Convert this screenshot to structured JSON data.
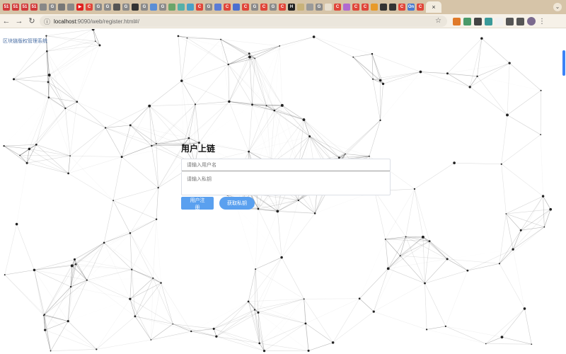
{
  "browser": {
    "tabs": [
      {
        "label": "51",
        "color": "#d23b3b"
      },
      {
        "label": "51",
        "color": "#d23b3b"
      },
      {
        "label": "51",
        "color": "#d23b3b"
      },
      {
        "label": "51",
        "color": "#d23b3b"
      },
      {
        "label": "",
        "color": "#888888"
      },
      {
        "label": "G",
        "color": "#8a8a8a"
      },
      {
        "label": "",
        "color": "#777777"
      },
      {
        "label": "",
        "color": "#888888"
      },
      {
        "label": "▶",
        "color": "#e02020"
      },
      {
        "label": "C",
        "color": "#e0463a"
      },
      {
        "label": "G",
        "color": "#8a8a8a"
      },
      {
        "label": "G",
        "color": "#8a8a8a"
      },
      {
        "label": "",
        "color": "#555555"
      },
      {
        "label": "G",
        "color": "#8a8a8a"
      },
      {
        "label": "",
        "color": "#333333"
      },
      {
        "label": "G",
        "color": "#8a8a8a"
      },
      {
        "label": "",
        "color": "#5a8ed6"
      },
      {
        "label": "G",
        "color": "#8a8a8a"
      },
      {
        "label": "",
        "color": "#6aa56a"
      },
      {
        "label": "",
        "color": "#55b0a8"
      },
      {
        "label": "",
        "color": "#4aa0c8"
      },
      {
        "label": "C",
        "color": "#e0463a"
      },
      {
        "label": "G",
        "color": "#8a8a8a"
      },
      {
        "label": "",
        "color": "#5a7bd6"
      },
      {
        "label": "C",
        "color": "#e0463a"
      },
      {
        "label": "",
        "color": "#4a6fd0"
      },
      {
        "label": "C",
        "color": "#e0463a"
      },
      {
        "label": "G",
        "color": "#8a8a8a"
      },
      {
        "label": "C",
        "color": "#e0463a"
      },
      {
        "label": "G",
        "color": "#8a8a8a"
      },
      {
        "label": "C",
        "color": "#e0463a"
      },
      {
        "label": "H",
        "color": "#222222"
      },
      {
        "label": "",
        "color": "#c8b27a"
      },
      {
        "label": "",
        "color": "#9a9a9a"
      },
      {
        "label": "G",
        "color": "#8a8a8a"
      },
      {
        "label": "",
        "color": "#e8e0d0"
      },
      {
        "label": "C",
        "color": "#e0463a"
      },
      {
        "label": "",
        "color": "#b06ad0"
      },
      {
        "label": "C",
        "color": "#e0463a"
      },
      {
        "label": "C",
        "color": "#e0463a"
      },
      {
        "label": "",
        "color": "#e89a2a"
      },
      {
        "label": "",
        "color": "#333333"
      },
      {
        "label": "",
        "color": "#333333"
      },
      {
        "label": "C",
        "color": "#e0463a"
      },
      {
        "label": "On",
        "color": "#4a7bd0"
      },
      {
        "label": "C",
        "color": "#e0463a"
      }
    ],
    "active_tab_close": "×",
    "tab_menu_icon": "⌄",
    "url_host": "localhost",
    "url_path": ":9090/web/register.html#/",
    "nav_back": "←",
    "nav_forward": "→",
    "nav_reload": "↻",
    "info_icon": "ⓘ",
    "star_icon": "☆",
    "kebab_icon": "⋮",
    "extensions": [
      "#e07a2a",
      "#4a9a6a",
      "#444444",
      "#3a9a9a",
      "#f0f0f0",
      "#555555",
      "#555555"
    ]
  },
  "page": {
    "brand": "区块链版权管理系统",
    "title": "用户上链",
    "username_placeholder": "请输入用户名",
    "privatekey_placeholder": "请输入私钥",
    "register_button": "用户注册",
    "getkey_button": "获取私钥",
    "accent_color": "#5aa0ef"
  }
}
